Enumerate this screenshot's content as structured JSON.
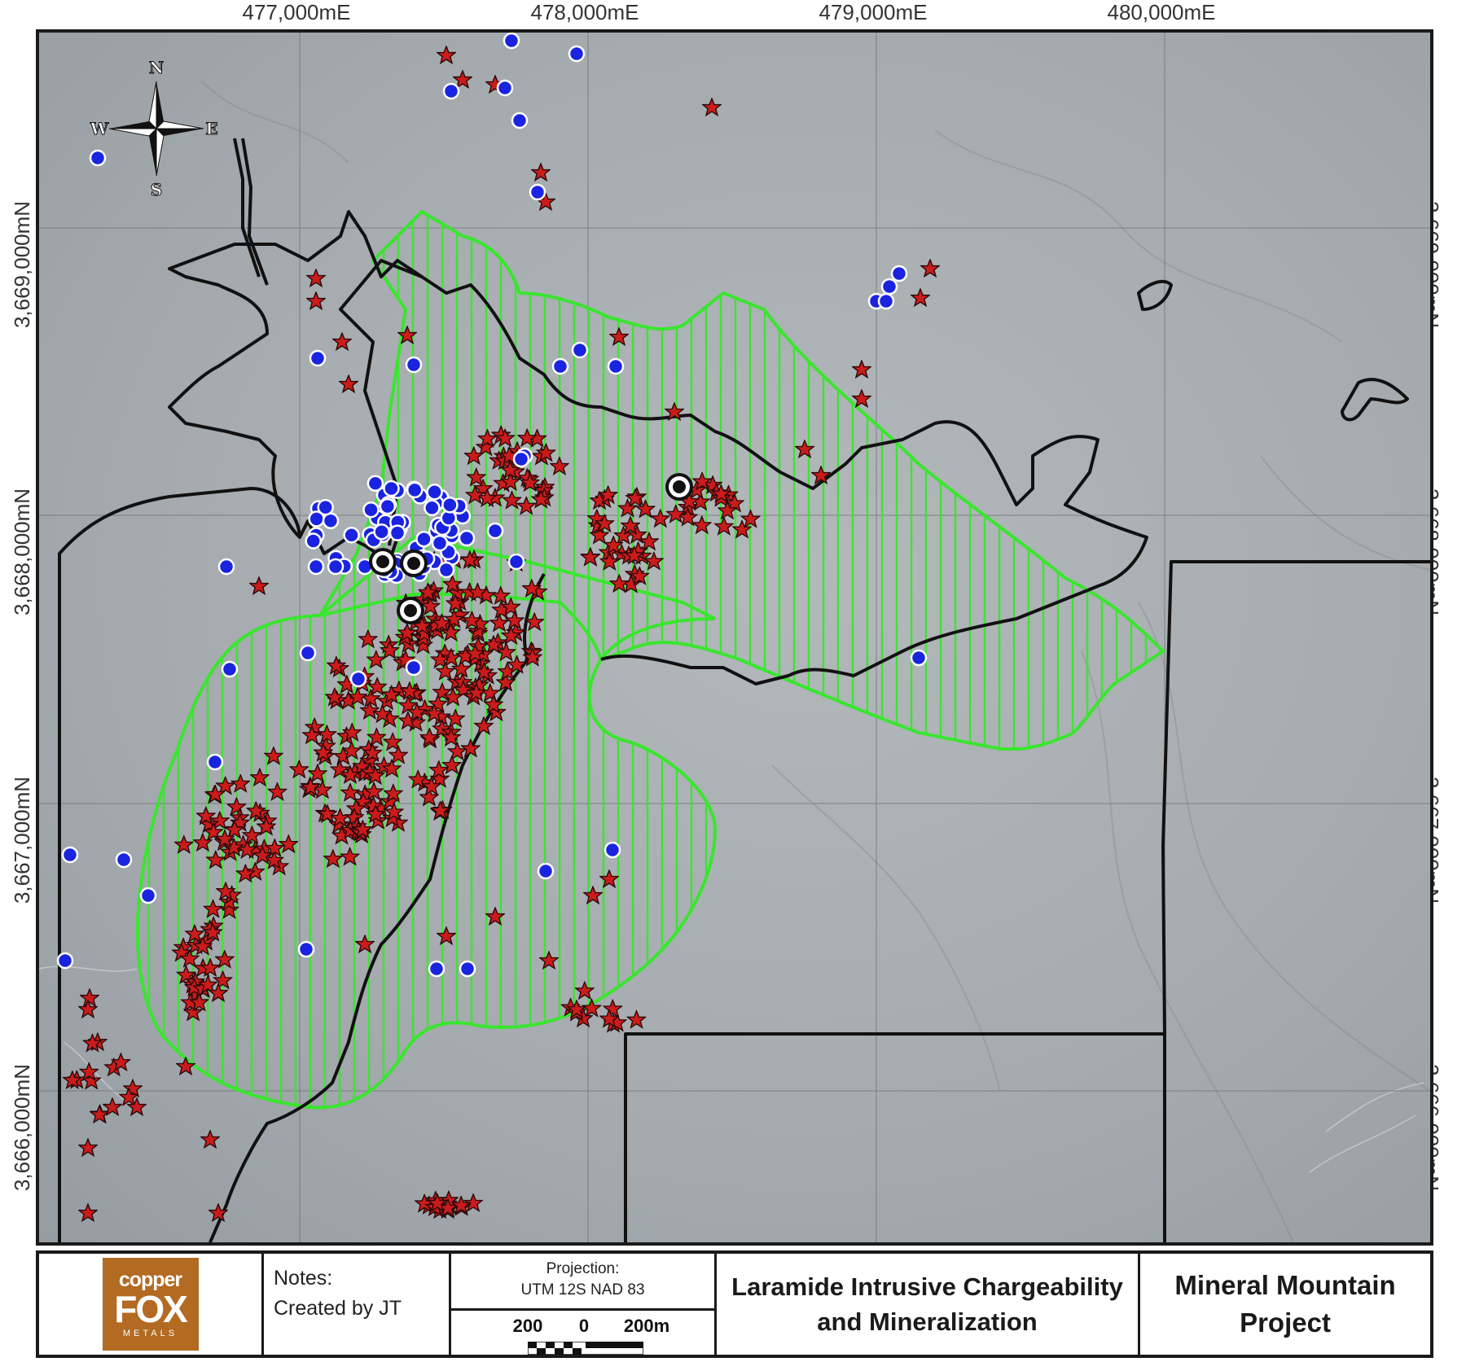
{
  "easting_labels": [
    {
      "text": "477,000mE"
    },
    {
      "text": "478,000mE"
    },
    {
      "text": "479,000mE"
    },
    {
      "text": "480,000mE"
    }
  ],
  "northing_labels": [
    {
      "text": "3,669,000mN"
    },
    {
      "text": "3,668,000mN"
    },
    {
      "text": "3,667,000mN"
    },
    {
      "text": "3,666,000mN"
    }
  ],
  "compass": {
    "n": "N",
    "s": "S",
    "e": "E",
    "w": "W"
  },
  "colors": {
    "terrain": "#a8aeb2",
    "grid": "#6f7478",
    "boundary": "#111111",
    "zone_outline": "#39e62e",
    "hatch": "#39e62e",
    "star_fill": "#cc1b1b",
    "star_stroke": "#2a0a0a",
    "dot_fill": "#1a24e0",
    "dot_stroke": "#ffffff",
    "logo_bg": "#b36a22"
  },
  "symbols": {
    "star": "red-star-sample-icon",
    "dot": "blue-dot-sample-icon",
    "target": "black-target-icon",
    "compass": "compass-rose-icon"
  },
  "logo": {
    "line1": "copper",
    "line2": "FOX",
    "line3": "METALS"
  },
  "notes": {
    "heading": "Notes:",
    "author": "Created by JT"
  },
  "projection": {
    "heading": "Projection:",
    "value": "UTM 12S NAD 83"
  },
  "scale": {
    "left": "200",
    "zero": "0",
    "right": "200m"
  },
  "map_title": {
    "line1": "Laramide Intrusive Chargeability",
    "line2": "and Mineralization"
  },
  "project": {
    "line1": "Mineral Mountain",
    "line2": "Project"
  }
}
